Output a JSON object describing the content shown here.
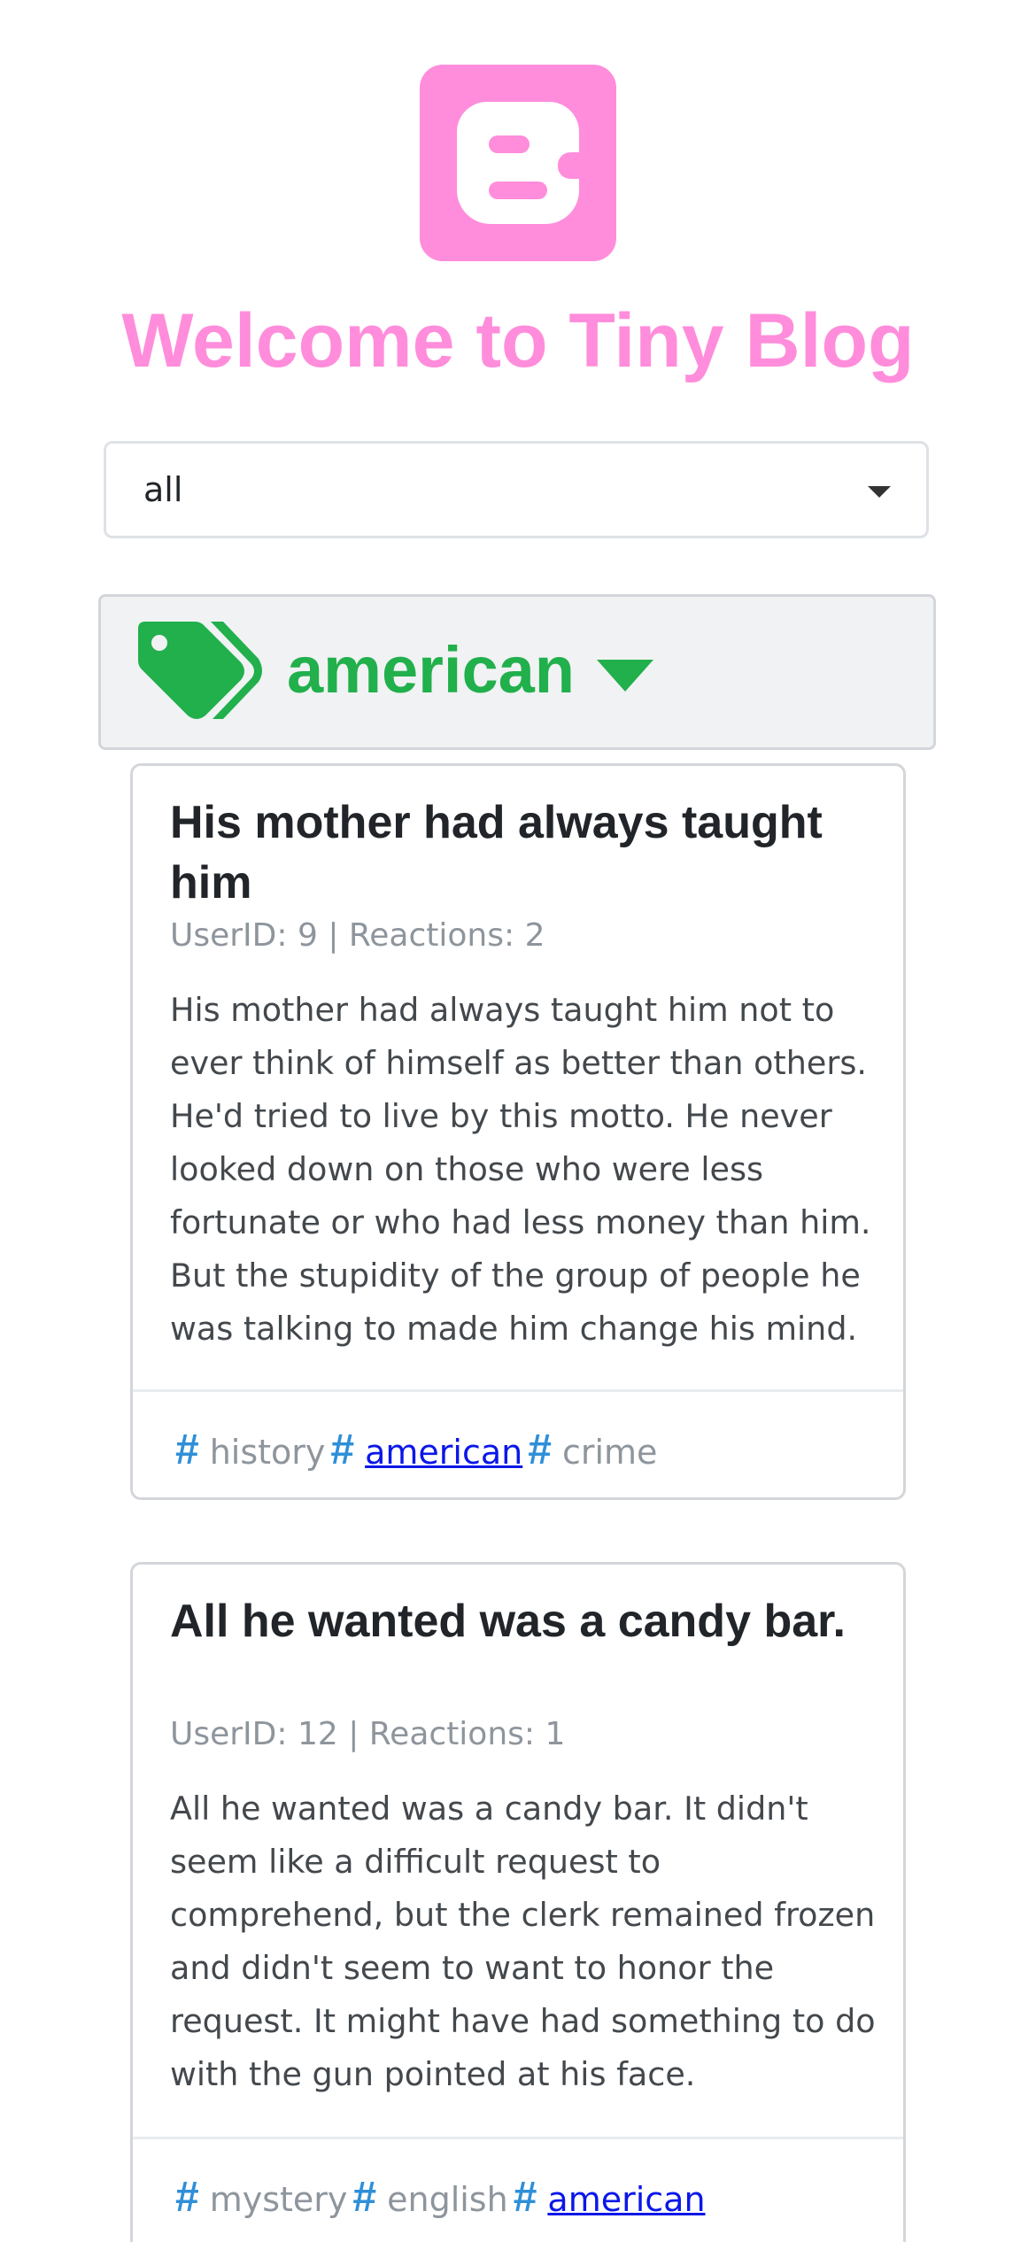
{
  "app": {
    "logo_icon": "blogger-icon",
    "title": "Welcome to Tiny Blog",
    "accent_color": "#ff8ddb"
  },
  "filter": {
    "selected": "all"
  },
  "tag_section": {
    "icon": "tags-icon",
    "label": "american",
    "color": "#21b04b"
  },
  "posts": [
    {
      "title": "His mother had always taught him",
      "meta": "UserID: 9 | Reactions: 2",
      "body": "His mother had always taught him not to ever think of himself as better than others. He'd tried to live by this motto. He never looked down on those who were less fortunate or who had less money than him. But the stupidity of the group of people he was talking to made him change his mind.",
      "tags": [
        "history",
        "american",
        "crime"
      ]
    },
    {
      "title": "All he wanted was a candy bar.",
      "meta": "UserID: 12 | Reactions: 1",
      "body": "All he wanted was a candy bar. It didn't seem like a difficult request to comprehend, but the clerk remained frozen and didn't seem to want to honor the request. It might have had something to do with the gun pointed at his face.",
      "tags": [
        "mystery",
        "english",
        "american"
      ]
    }
  ]
}
